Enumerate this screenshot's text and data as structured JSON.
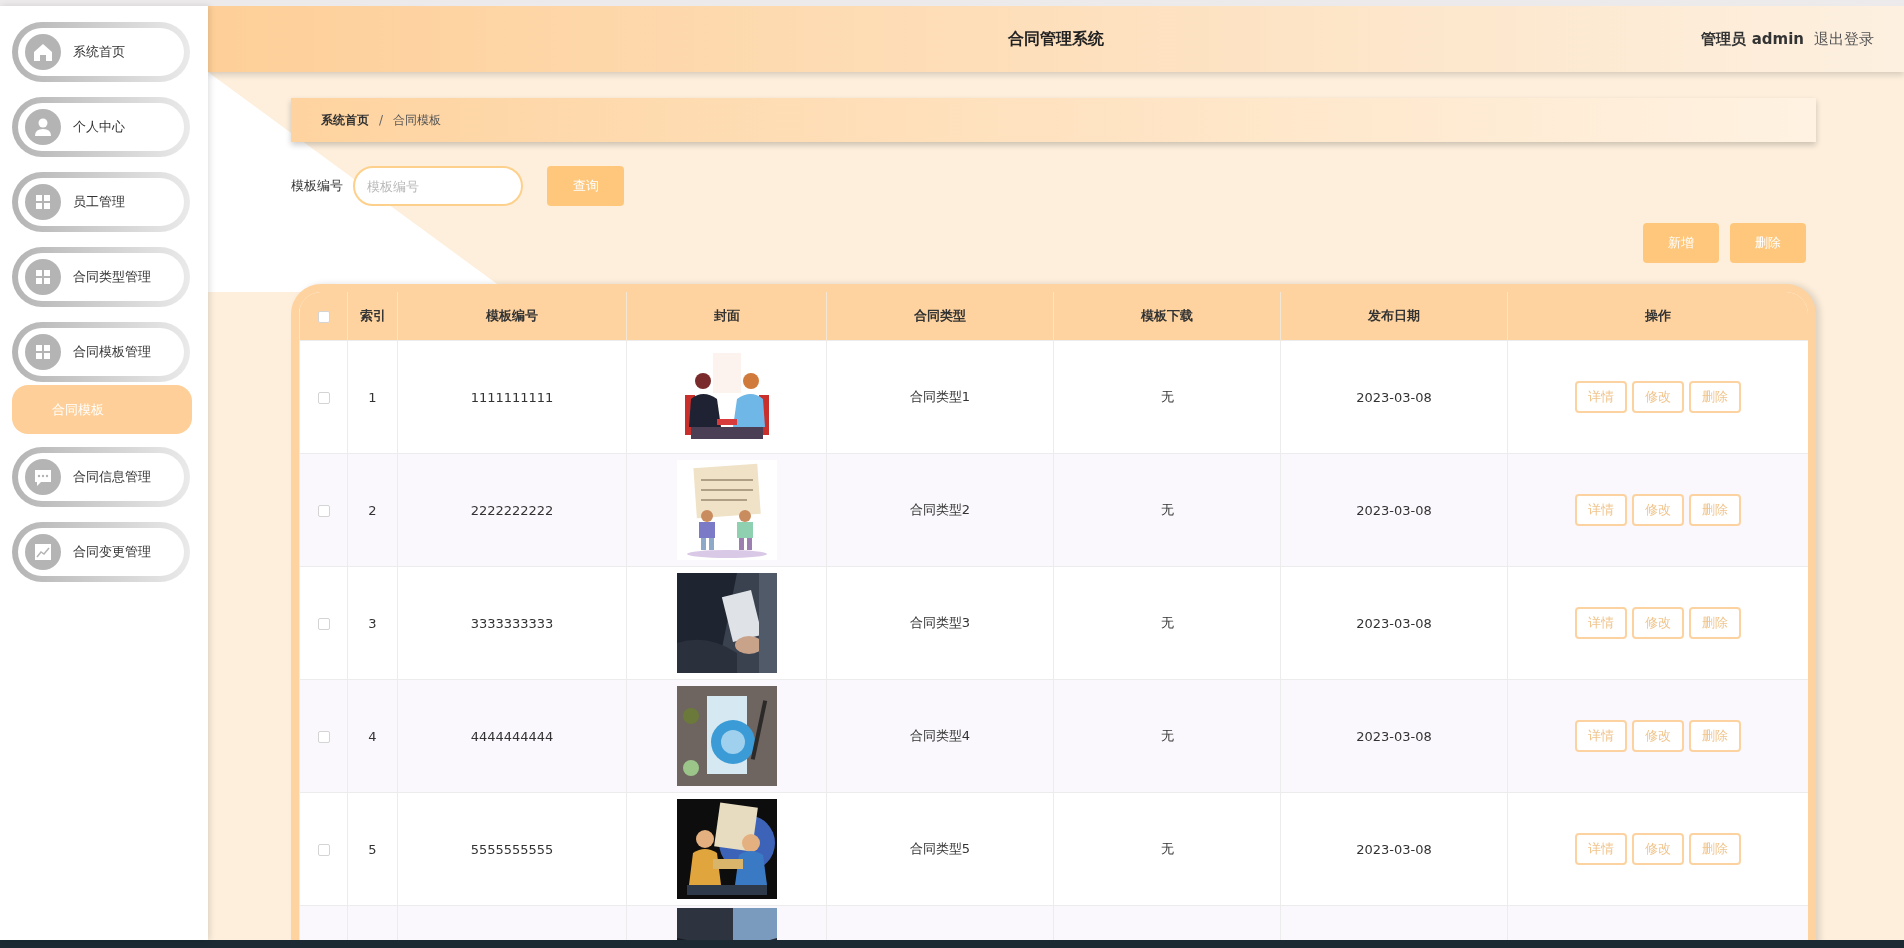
{
  "sidebar": {
    "items": [
      {
        "label": "系统首页",
        "kind": "home"
      },
      {
        "label": "个人中心",
        "kind": "user"
      },
      {
        "label": "员工管理",
        "kind": "grid"
      },
      {
        "label": "合同类型管理",
        "kind": "grid"
      },
      {
        "label": "合同模板管理",
        "kind": "grid",
        "children": [
          {
            "label": "合同模板",
            "selected": true
          }
        ]
      },
      {
        "label": "合同信息管理",
        "kind": "chat"
      },
      {
        "label": "合同变更管理",
        "kind": "chart"
      }
    ]
  },
  "header": {
    "title": "合同管理系统",
    "user": "管理员 admin",
    "logout": "退出登录"
  },
  "breadcrumb": {
    "items": [
      "系统首页",
      "合同模板"
    ],
    "separator": "/"
  },
  "search": {
    "label": "模板编号",
    "placeholder": "模板编号",
    "button": "查询"
  },
  "actions": [
    "新增",
    "删除"
  ],
  "table": {
    "select_all_checked": false,
    "columns": [
      "索引",
      "模板编号",
      "封面",
      "合同类型",
      "模板下载",
      "发布日期",
      "操作"
    ],
    "rows": [
      {
        "checked": false,
        "index": "1",
        "code": "1111111111",
        "type": "合同类型1",
        "download": "无",
        "date": "2023-03-08",
        "actions": [
          "详情",
          "修改",
          "删除"
        ]
      },
      {
        "checked": false,
        "index": "2",
        "code": "2222222222",
        "type": "合同类型2",
        "download": "无",
        "date": "2023-03-08",
        "actions": [
          "详情",
          "修改",
          "删除"
        ]
      },
      {
        "checked": false,
        "index": "3",
        "code": "3333333333",
        "type": "合同类型3",
        "download": "无",
        "date": "2023-03-08",
        "actions": [
          "详情",
          "修改",
          "删除"
        ]
      },
      {
        "checked": false,
        "index": "4",
        "code": "4444444444",
        "type": "合同类型4",
        "download": "无",
        "date": "2023-03-08",
        "actions": [
          "详情",
          "修改",
          "删除"
        ]
      },
      {
        "checked": false,
        "index": "5",
        "code": "5555555555",
        "type": "合同类型5",
        "download": "无",
        "date": "2023-03-08",
        "actions": [
          "详情",
          "修改",
          "删除"
        ]
      }
    ]
  }
}
